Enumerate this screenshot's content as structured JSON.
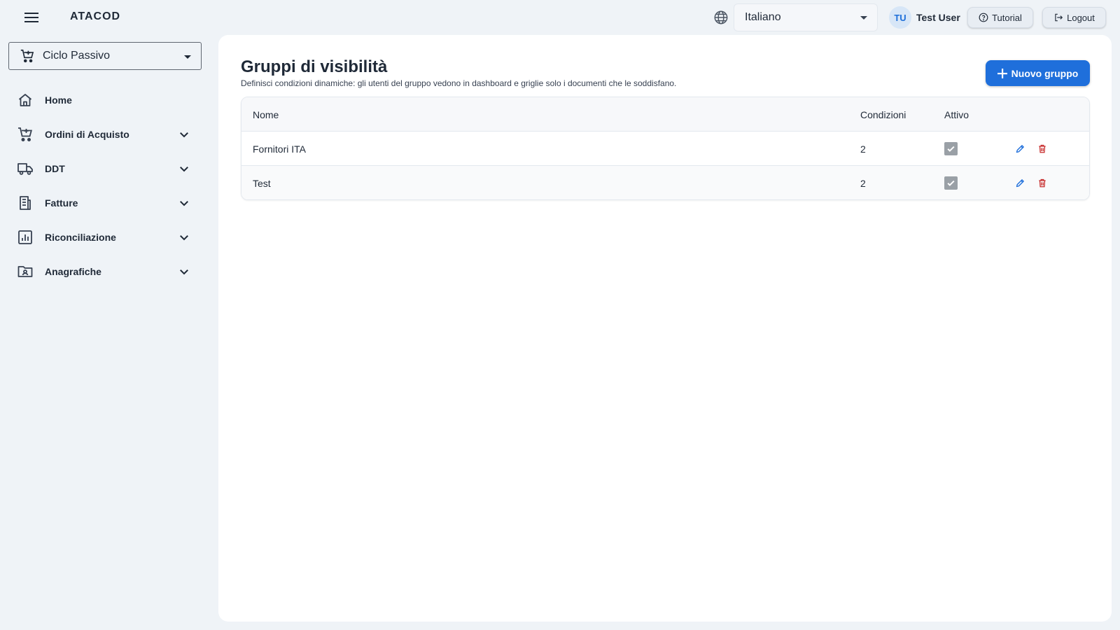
{
  "topbar": {
    "app_title": "ATACOD",
    "language": {
      "selected": "Italiano"
    },
    "user": {
      "initials": "TU",
      "name": "Test User"
    },
    "tutorial_label": "Tutorial",
    "logout_label": "Logout"
  },
  "sidebar": {
    "module": "Ciclo Passivo",
    "items": [
      {
        "label": "Home",
        "icon": "home-icon",
        "expandable": false
      },
      {
        "label": "Ordini di Acquisto",
        "icon": "cart-icon",
        "expandable": true
      },
      {
        "label": "DDT",
        "icon": "truck-icon",
        "expandable": true
      },
      {
        "label": "Fatture",
        "icon": "receipt-icon",
        "expandable": true
      },
      {
        "label": "Riconciliazione",
        "icon": "chart-icon",
        "expandable": true
      },
      {
        "label": "Anagrafiche",
        "icon": "contact-folder-icon",
        "expandable": true
      }
    ]
  },
  "main": {
    "title": "Gruppi di visibilità",
    "subtitle": "Definisci condizioni dinamiche: gli utenti del gruppo vedono in dashboard e griglie solo i documenti che le soddisfano.",
    "new_button_label": "Nuovo gruppo",
    "table": {
      "columns": [
        "Nome",
        "Condizioni",
        "Attivo"
      ],
      "rows": [
        {
          "name": "Fornitori ITA",
          "conditions": "2",
          "active": true
        },
        {
          "name": "Test",
          "conditions": "2",
          "active": true
        }
      ]
    }
  },
  "colors": {
    "accent": "#1f6fdb",
    "danger": "#c62828",
    "background": "#eff3f7",
    "panel": "#ffffff"
  }
}
